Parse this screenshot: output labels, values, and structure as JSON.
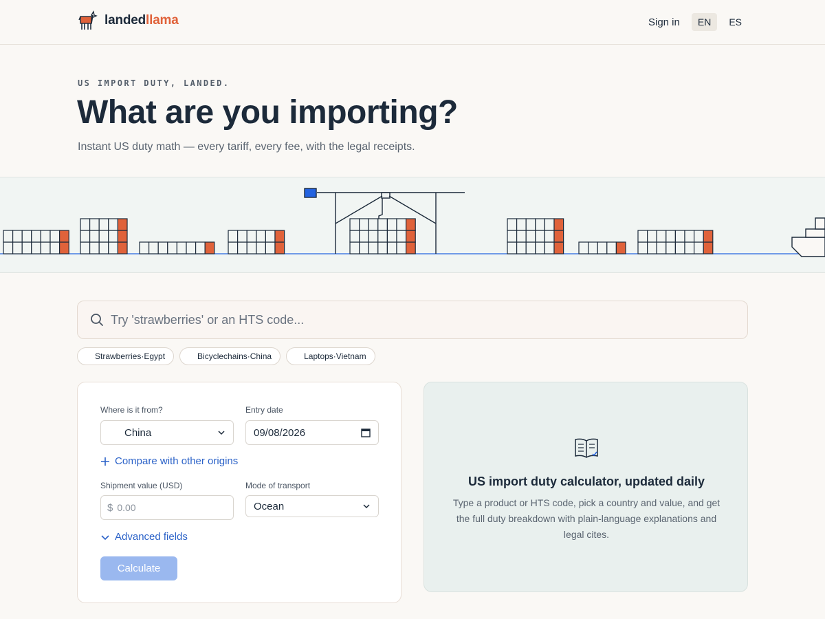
{
  "header": {
    "brand_part1": "landed",
    "brand_part2": "llama",
    "signin": "Sign in",
    "languages": [
      "EN",
      "ES"
    ],
    "active_language": "EN"
  },
  "hero": {
    "eyebrow": "US IMPORT DUTY, LANDED.",
    "title": "What are you importing?",
    "subtitle": "Instant US duty math — every tariff, every fee, with the legal receipts."
  },
  "search": {
    "placeholder": "Try 'strawberries' or an HTS code..."
  },
  "examples": [
    "Strawberries·Egypt",
    "Bicyclechains·China",
    "Laptops·Vietnam"
  ],
  "form": {
    "origin_label": "Where is it from?",
    "origin_value": "China",
    "date_label": "Entry date",
    "date_value": "09/08/2026",
    "compare_link": "Compare with other origins",
    "value_label": "Shipment value (USD)",
    "currency_symbol": "$",
    "value_placeholder": "0.00",
    "mode_label": "Mode of transport",
    "mode_value": "Ocean",
    "advanced_link": "Advanced fields",
    "calculate": "Calculate"
  },
  "info": {
    "icon": "open-book-icon",
    "title": "US import duty calculator, updated daily",
    "body": "Type a product or HTS code, pick a country and value, and get the full duty breakdown with plain-language explanations and legal cites."
  },
  "colors": {
    "accent_orange": "#e0623a",
    "link_blue": "#2b62c8",
    "crane_blue": "#2463e0",
    "ink": "#1c2a3a"
  }
}
